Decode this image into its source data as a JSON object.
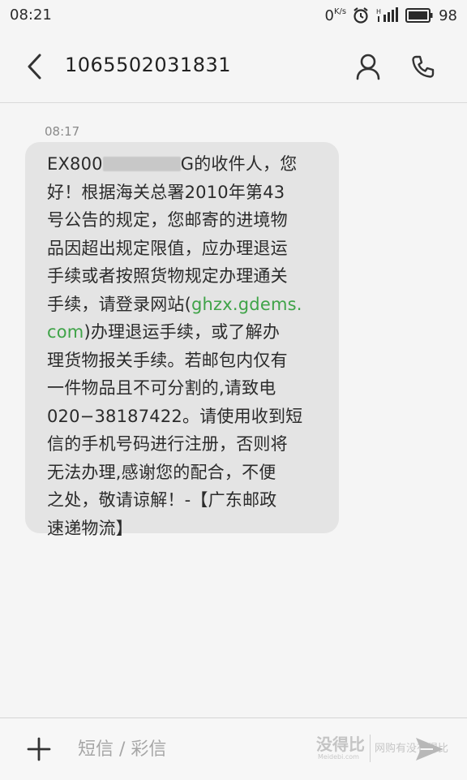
{
  "status_bar": {
    "time": "08:21",
    "net_speed": "0",
    "net_speed_unit": "K/s",
    "network_type": "H",
    "battery": "98"
  },
  "header": {
    "title": "1065502031831",
    "back_icon": "chevron-left-icon",
    "contact_icon": "person-icon",
    "call_icon": "phone-icon"
  },
  "conversation": {
    "message_time": "08:17",
    "message": {
      "l1_pre": "EX800",
      "l1_post": "G的收件人，您",
      "l2": "好！根据海关总署2010年第43",
      "l3": "号公告的规定，您邮寄的进境物",
      "l4": "品因超出规定限值，应办理退运",
      "l5": "手续或者按照货物规定办理通关",
      "l6_pre": "手续，请登录网站(",
      "l6_link": "ghzx.gdems.",
      "l7_link": "com",
      "l7_post": ")办理退运手续，或了解办",
      "l8": "理货物报关手续。若邮包内仅有",
      "l9": "一件物品且不可分割的,请致电",
      "l10": "020−38187422。请使用收到短",
      "l11": "信的手机号码进行注册，否则将",
      "l12": "无法办理,感谢您的配合，不便",
      "l13": "之处，敬请谅解！-【广东邮政",
      "l14": "速递物流】"
    }
  },
  "input_bar": {
    "add_icon": "plus-icon",
    "placeholder": "短信 / 彩信",
    "send_icon": "send-icon",
    "watermark_main": "没得比",
    "watermark_sub": "Meidebi.com",
    "watermark_slogan": "网购有没有得比"
  },
  "colors": {
    "background": "#f5f5f5",
    "bubble": "#e4e4e4",
    "link": "#3fa348"
  }
}
